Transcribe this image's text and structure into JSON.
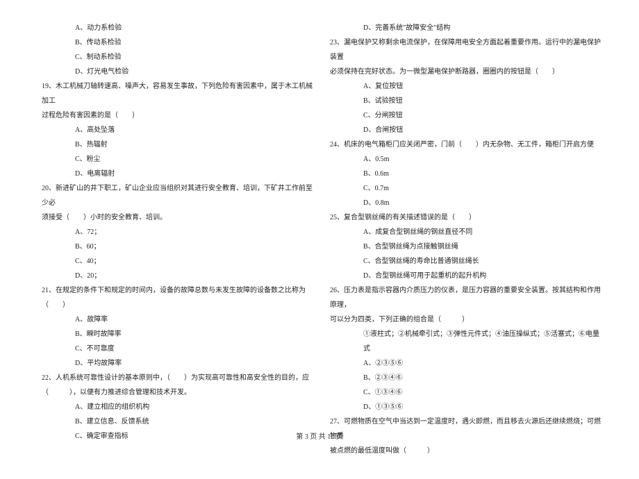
{
  "left": {
    "q18_opts": [
      "A、动力系检验",
      "B、传动系检验",
      "C、制动系检验",
      "D、灯光电气检验"
    ],
    "q19": "19、木工机械刀轴转速高、噪声大，容易发生事故，下列危险有害因素中，属于木工机械加工",
    "q19_cont": "过程危险有害因素的是（　　）",
    "q19_opts": [
      "A、高处坠落",
      "B、热辐射",
      "C、粉尘",
      "D、电离辐射"
    ],
    "q20": "20、新进矿山的井下职工，矿山企业应当组织对其进行安全教育、培训，下矿井工作前至少必",
    "q20_cont": "须接受（　　）小时的安全教育、培训。",
    "q20_opts": [
      "A、72；",
      "B、60；",
      "C、40；",
      "D、20；"
    ],
    "q21": "21、在规定的条件下和规定的时间内，设备的故障总数与未发生故障的设备数之比称为（　　）",
    "q21_opts": [
      "A、故障率",
      "B、瞬时故障率",
      "C、不可靠度",
      "D、平均故障率"
    ],
    "q22": "22、人机系统可靠性设计的基本原则中，（　　）为实现高可靠性和高安全性的目的，应",
    "q22_cont": "（　　　），以便有力推进综合管理和技术开发。",
    "q22_opts": [
      "A、建立相应的组织机构",
      "B、建立信息、反馈系统",
      "C、确定审查指标"
    ]
  },
  "right": {
    "q22_optD": "D、完善系统\"故障安全\"结构",
    "q23": "23、漏电保护又称剩余电流保护，在保障用电安全方面起着重要作用。运行中的漏电保护装置",
    "q23_cont": "必须保持在完好状态。为一微型漏电保护断路器，圈圈内的按钮是（　　）",
    "q23_opts": [
      "A、复位按钮",
      "B、试验按钮",
      "C、分闸按钮",
      "D、合闸按钮"
    ],
    "q24": "24、机床的电气箱柜门应关闭严密，门前（　　）内无杂物、无工件，箱柜门开启方便",
    "q24_opts": [
      "A、0.5m",
      "B、0.6m",
      "C、0.7m",
      "D、0.8m"
    ],
    "q25": "25、复合型钢丝绳的有关描述错误的是（　　）",
    "q25_opts": [
      "A、成复合型钢丝绳的钢丝直径不同",
      "B、合型钢丝绳为点接触钢丝绳",
      "C、合型钢丝绳的寿命比普通钢丝绳长",
      "D、合型钢丝绳可用于起重机的起升机构"
    ],
    "q26": "26、压力表是指示容器内介质压力的仪表，是压力容器的重要安全装置。按其结构和作用原理，",
    "q26_cont": "可以分为四类，下列正确的组合是（　　　）",
    "q26_subline": "①液柱式；②机械牵引式；③弹性元件式；④油压操纵式；⑤活塞式；⑥电量式",
    "q26_opts": [
      "A、②③⑤⑥",
      "B、②③④⑥",
      "C、①③④⑥",
      "D、①③⑤⑥"
    ],
    "q27": "27、可燃物质在空气中当达到一定温度时，遇火即燃，而且移去火源后还继续燃烧；可燃物质",
    "q27_cont": "被点燃的最低温度叫做（　　　）"
  },
  "footer": "第 3 页 共 12 页"
}
